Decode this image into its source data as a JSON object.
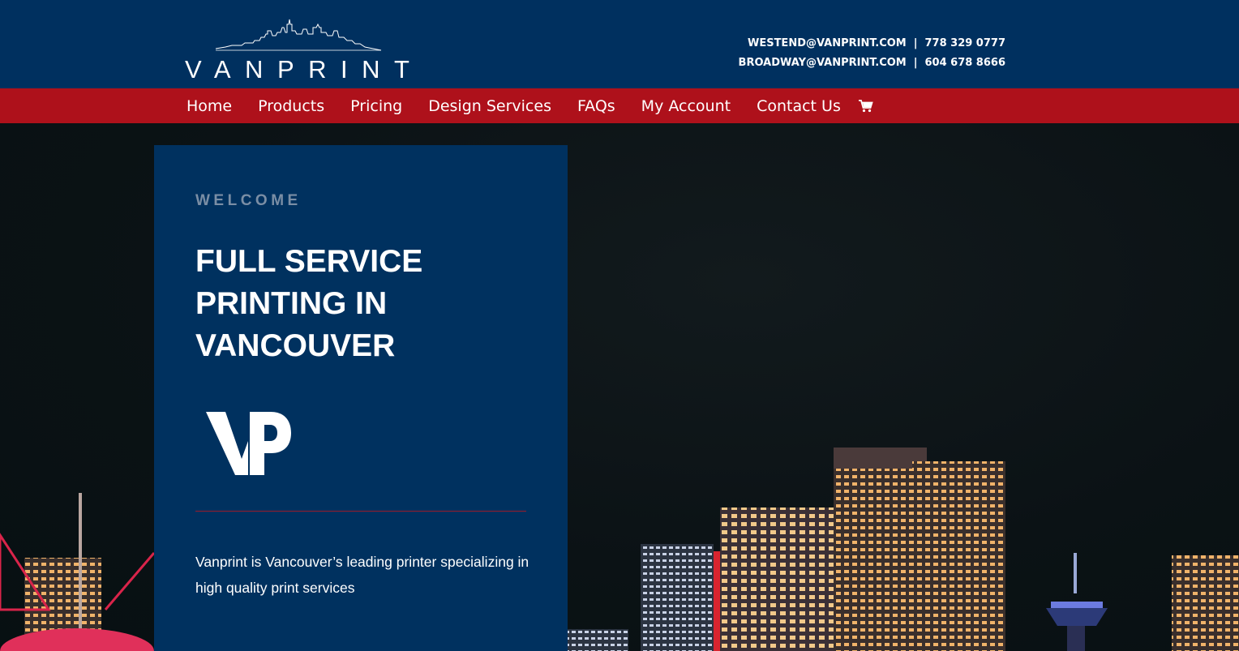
{
  "brand": {
    "logo_text": "VANPRINT"
  },
  "contact": [
    {
      "email": "WESTEND@VANPRINT.COM",
      "phone": "778 329 0777"
    },
    {
      "email": "BROADWAY@VANPRINT.COM",
      "phone": "604 678 8666"
    }
  ],
  "nav": {
    "items": [
      "Home",
      "Products",
      "Pricing",
      "Design Services",
      "FAQs",
      "My Account",
      "Contact Us"
    ],
    "cart_icon": "shopping-cart-icon"
  },
  "hero": {
    "eyebrow": "WELCOME",
    "headline_lines": [
      "FULL SERVICE",
      "PRINTING IN",
      "VANCOUVER"
    ],
    "vp_logo_text": "VP",
    "description": "Vanprint is Vancouver’s leading printer specializing in high quality print services"
  },
  "colors": {
    "header_bg": "#00305f",
    "nav_bg": "#ae111b",
    "card_bg": "#00315f",
    "divider": "#9c1c2a",
    "eyebrow": "#7a8ea5"
  }
}
